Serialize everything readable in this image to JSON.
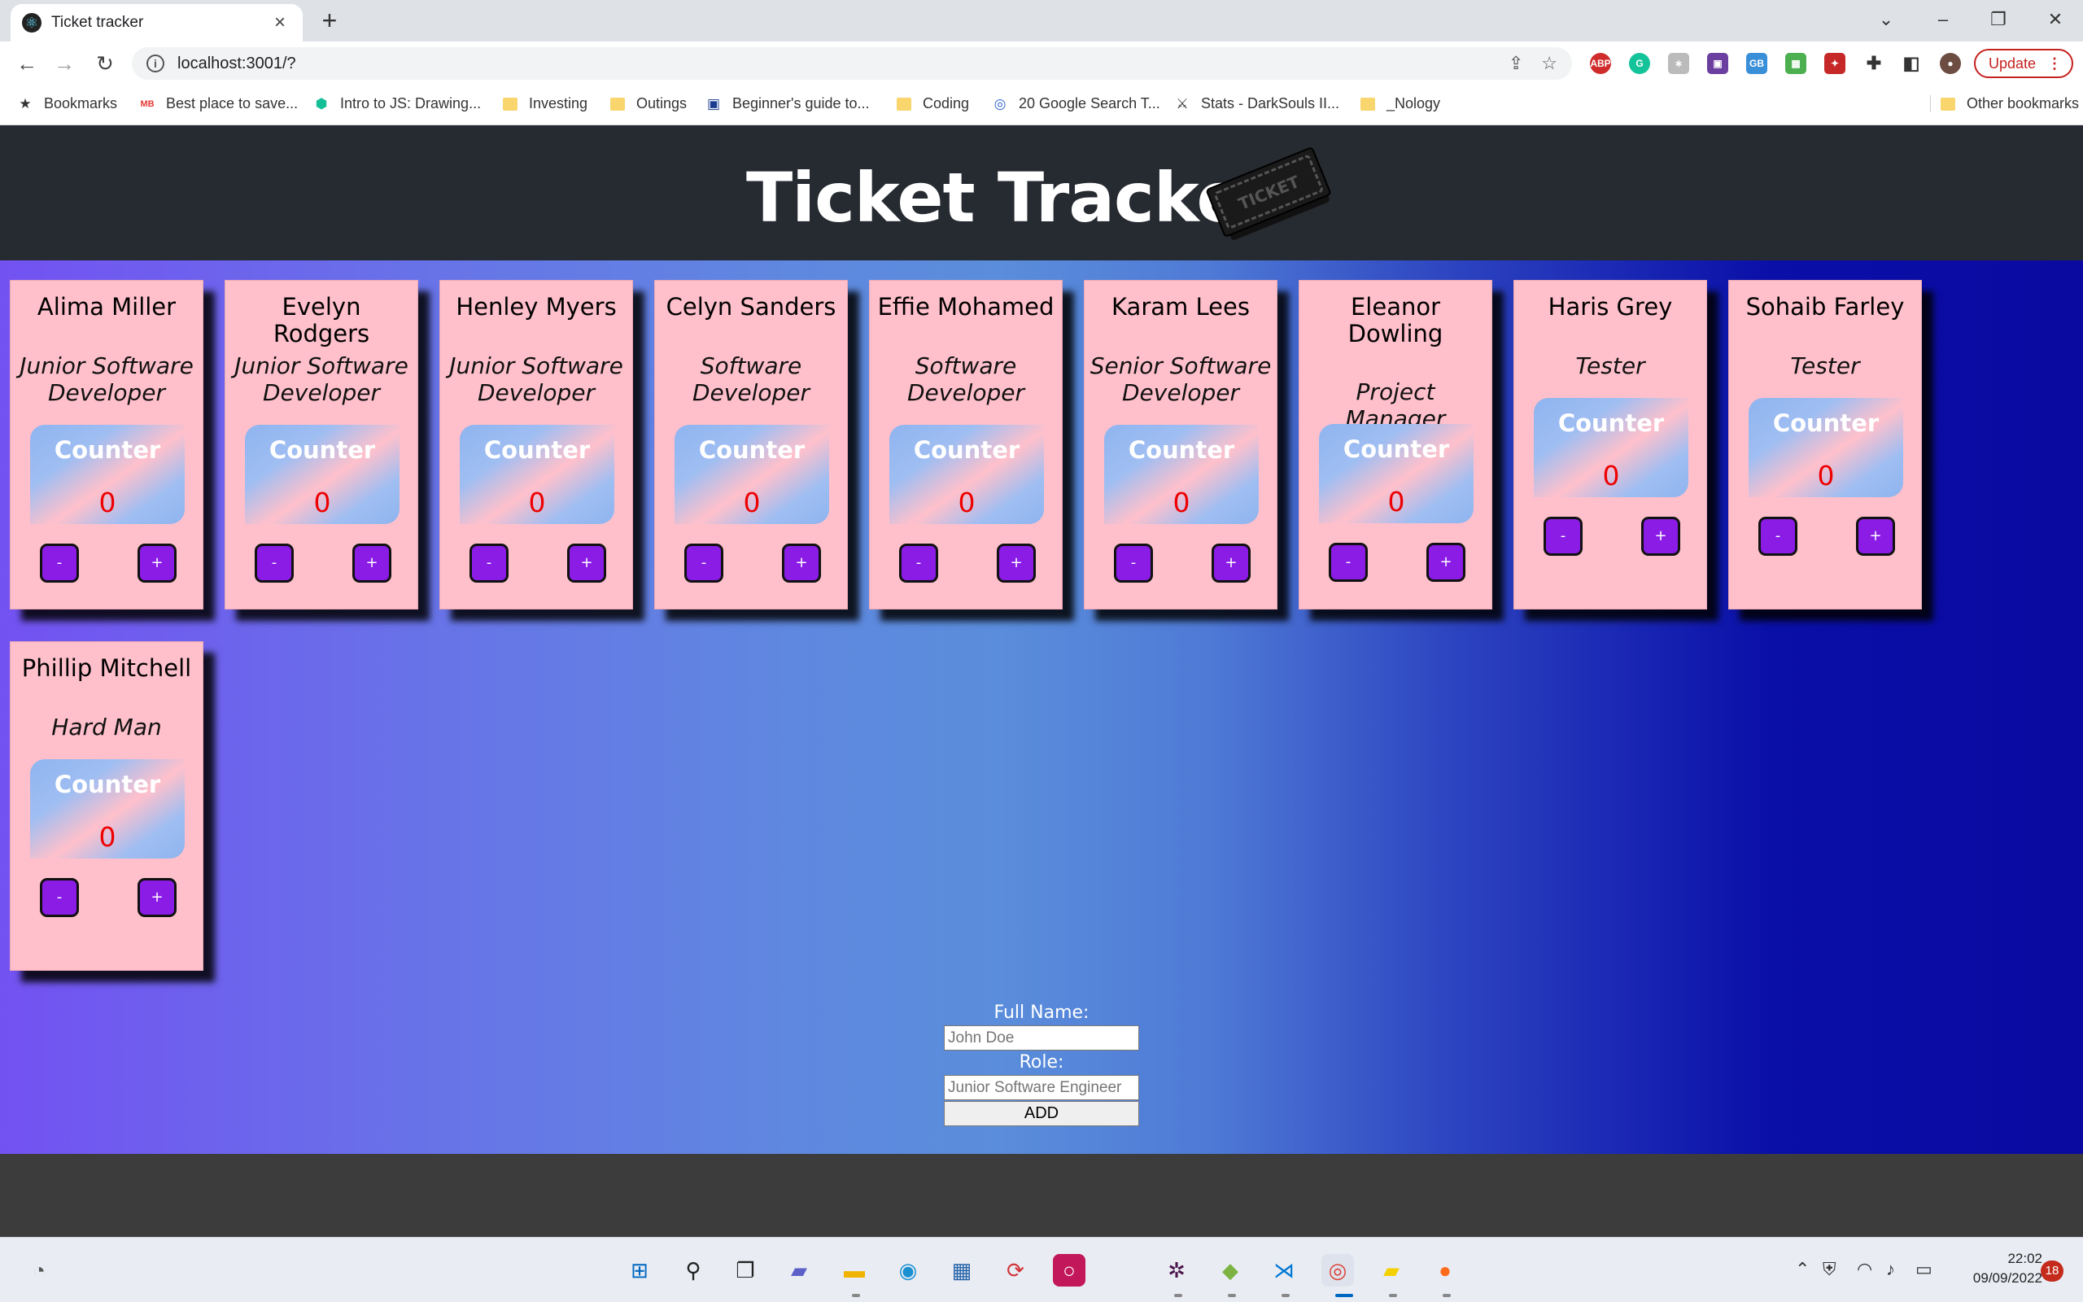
{
  "browser": {
    "tab_title": "Ticket tracker",
    "url": "localhost:3001/?",
    "update_label": "Update",
    "bookmarks": [
      {
        "label": "Bookmarks",
        "icon": "star-icon"
      },
      {
        "label": "Best place to save...",
        "icon": "site-icon"
      },
      {
        "label": "Intro to JS: Drawing...",
        "icon": "khan-icon"
      },
      {
        "label": "Investing",
        "icon": "folder-icon"
      },
      {
        "label": "Outings",
        "icon": "folder-icon"
      },
      {
        "label": "Beginner's guide to...",
        "icon": "site-icon"
      },
      {
        "label": "Coding",
        "icon": "folder-icon"
      },
      {
        "label": "20 Google Search T...",
        "icon": "site-icon"
      },
      {
        "label": "Stats - DarkSouls II...",
        "icon": "site-icon"
      },
      {
        "label": "_Nology",
        "icon": "folder-icon"
      }
    ],
    "other_bookmarks": "Other bookmarks"
  },
  "header": {
    "title": "Ticket Tracker",
    "logo_text": "TICKET"
  },
  "counter_label": "Counter",
  "minus_label": "-",
  "plus_label": "+",
  "employees": [
    {
      "name": "Alima Miller",
      "role": "Junior Software Developer",
      "count": "0"
    },
    {
      "name": "Evelyn Rodgers",
      "role": "Junior Software Developer",
      "count": "0"
    },
    {
      "name": "Henley Myers",
      "role": "Junior Software Developer",
      "count": "0"
    },
    {
      "name": "Celyn Sanders",
      "role": "Software Developer",
      "count": "0"
    },
    {
      "name": "Effie Mohamed",
      "role": "Software Developer",
      "count": "0"
    },
    {
      "name": "Karam Lees",
      "role": "Senior Software Developer",
      "count": "0"
    },
    {
      "name": "Eleanor Dowling",
      "role": "Project Manager",
      "count": "0"
    },
    {
      "name": "Haris Grey",
      "role": "Tester",
      "count": "0"
    },
    {
      "name": "Sohaib Farley",
      "role": "Tester",
      "count": "0"
    },
    {
      "name": "Phillip Mitchell",
      "role": "Hard Man",
      "count": "0"
    }
  ],
  "form": {
    "name_label": "Full Name:",
    "name_placeholder": "John Doe",
    "role_label": "Role:",
    "role_placeholder": "Junior Software Engineer",
    "add_label": "ADD"
  },
  "taskbar": {
    "time": "22:02",
    "date": "09/09/2022",
    "notifications": "18"
  }
}
